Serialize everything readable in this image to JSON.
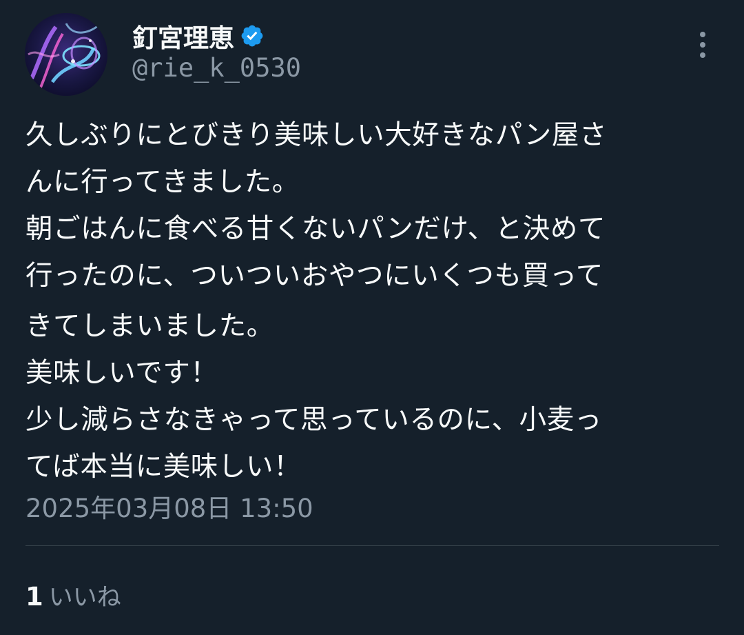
{
  "author": {
    "display_name": "釘宮理恵",
    "handle": "@rie_k_0530",
    "verified": true
  },
  "tweet": {
    "lines": [
      "久しぶりにとびきり美味しい大好きなパン屋さ",
      "んに行ってきました。",
      "朝ごはんに食べる甘くないパンだけ、と決めて",
      "行ったのに、ついついおやつにいくつも買って",
      "きてしまいました。",
      "美味しいです！",
      "少し減らさなきゃって思っているのに、小麦っ",
      "てば本当に美味しい！"
    ],
    "timestamp": "2025年03月08日 13:50"
  },
  "engagement": {
    "likes_count": "1",
    "likes_label": "いいね"
  },
  "colors": {
    "background": "#15202b",
    "text_primary": "#f7f9f9",
    "text_secondary": "#8b98a5",
    "divider": "#38444d",
    "verified_badge": "#1d9bf0"
  },
  "icons": {
    "verified": "verified-badge-icon",
    "more": "more-vertical-icon"
  }
}
